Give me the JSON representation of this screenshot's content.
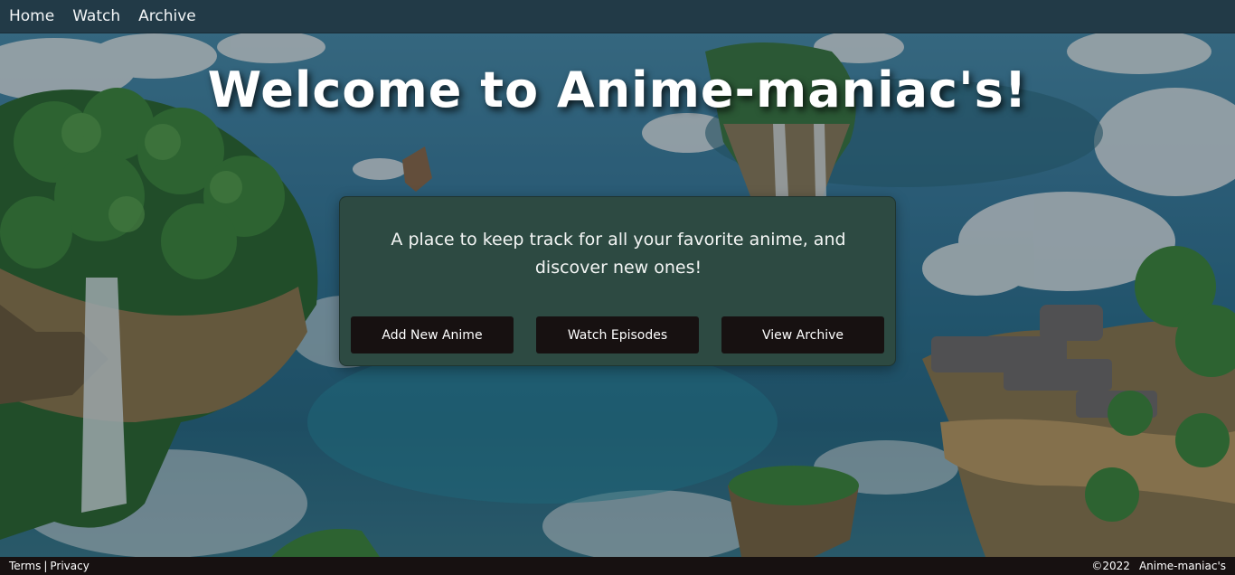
{
  "nav": {
    "items": [
      {
        "label": "Home"
      },
      {
        "label": "Watch"
      },
      {
        "label": "Archive"
      }
    ]
  },
  "hero": {
    "title": "Welcome to Anime-maniac's!"
  },
  "card": {
    "description": "A place to keep track for all your favorite anime, and discover new ones!",
    "buttons": [
      {
        "label": "Add New Anime"
      },
      {
        "label": "Watch Episodes"
      },
      {
        "label": "View Archive"
      }
    ]
  },
  "footer": {
    "terms": "Terms",
    "separator": "|",
    "privacy": "Privacy",
    "copyright": "©2022",
    "brand": "Anime-maniac's"
  },
  "colors": {
    "navbar": "#223a47",
    "card": "#2d4a42",
    "button": "#171111",
    "footer": "#171111",
    "text": "#ffffff"
  }
}
